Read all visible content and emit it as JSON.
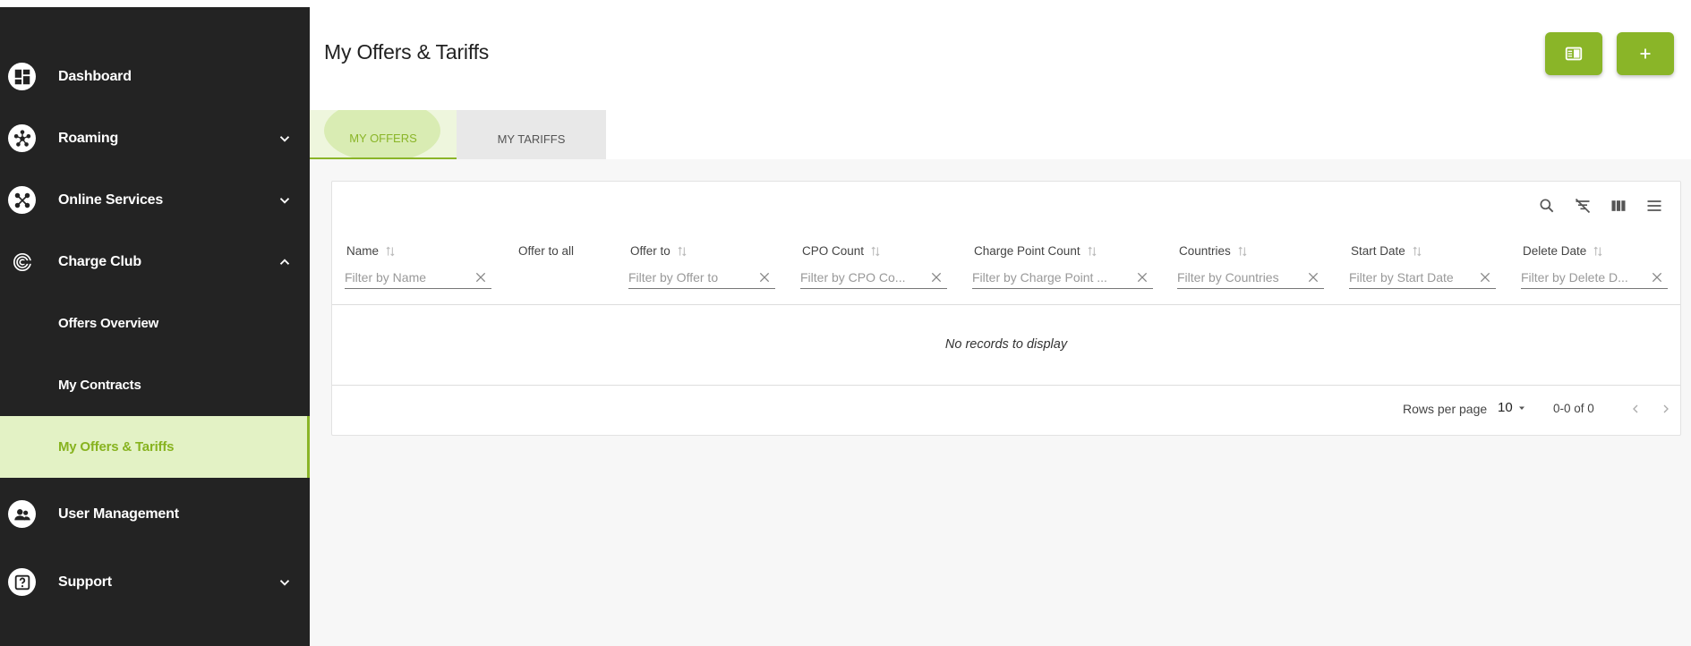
{
  "sidebar": {
    "items": [
      {
        "label": "Dashboard",
        "icon": "dashboard-icon"
      },
      {
        "label": "Roaming",
        "icon": "roaming-icon",
        "chevron": "down"
      },
      {
        "label": "Online Services",
        "icon": "online-services-icon",
        "chevron": "down"
      },
      {
        "label": "Charge Club",
        "icon": "charge-club-icon",
        "chevron": "up"
      },
      {
        "label": "User Management",
        "icon": "user-management-icon"
      },
      {
        "label": "Support",
        "icon": "support-icon",
        "chevron": "down"
      }
    ],
    "subitems": [
      {
        "label": "Offers Overview"
      },
      {
        "label": "My Contracts"
      },
      {
        "label": "My Offers & Tariffs",
        "active": true
      }
    ],
    "accent": "#8ab528"
  },
  "header": {
    "title": "My Offers & Tariffs"
  },
  "tabs": [
    {
      "label": "MY OFFERS",
      "active": true
    },
    {
      "label": "MY TARIFFS",
      "active": false
    }
  ],
  "table": {
    "columns": [
      {
        "label": "Name",
        "placeholder": "Filter by Name"
      },
      {
        "label": "Offer to all"
      },
      {
        "label": "Offer to",
        "placeholder": "Filter by Offer to"
      },
      {
        "label": "CPO Count",
        "placeholder": "Filter by CPO Co..."
      },
      {
        "label": "Charge Point Count",
        "placeholder": "Filter by Charge Point ..."
      },
      {
        "label": "Countries",
        "placeholder": "Filter by Countries"
      },
      {
        "label": "Start Date",
        "placeholder": "Filter by Start Date"
      },
      {
        "label": "Delete Date",
        "placeholder": "Filter by Delete D..."
      }
    ],
    "empty_message": "No records to display",
    "footer": {
      "rows_per_page_label": "Rows per page",
      "rows_per_page_value": "10",
      "range": "0-0 of 0"
    }
  },
  "colors": {
    "accent": "#8ab528",
    "sidebar_bg": "#232323",
    "active_bg": "#e3f2c5"
  }
}
